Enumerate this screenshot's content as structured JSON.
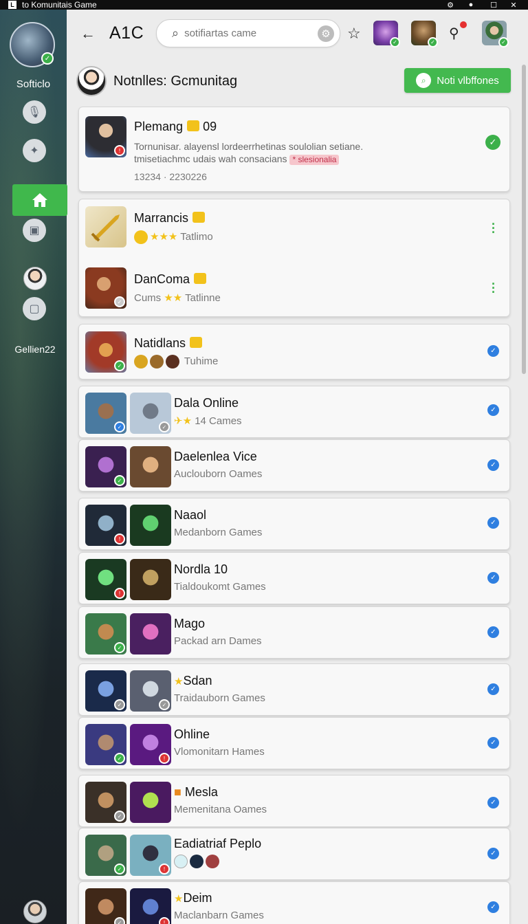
{
  "window": {
    "title": "to Komunitais Game",
    "controls": [
      "settings-icon",
      "record-icon",
      "maximize-icon",
      "close-icon"
    ]
  },
  "sidebar": {
    "profile_name": "Softiclo",
    "label2": "Gellien22"
  },
  "topbar": {
    "title": "A1C",
    "search_placeholder": "sotifiartas came"
  },
  "notifications": {
    "header_title": "Notnlles: Gcmunitag",
    "button_label": "Noti vlbffones"
  },
  "cards": [
    {
      "title": "Plemang",
      "title_suffix": "09",
      "body_line1": "Tornunisar. alayensl lordeerrhetinas soulolian setiane.",
      "body_line2": "tmisetiachmc udais wah consacians",
      "tag": "* slesionalia",
      "date": "13234 · 2230226"
    },
    {
      "title": "Marrancis",
      "sub": "Tatlimo"
    },
    {
      "title": "DanComa",
      "sub_prefix": "Cums",
      "sub": "Tatlinne"
    },
    {
      "title": "Natidlans",
      "sub": "Tuhime"
    },
    {
      "title": "Dala Online",
      "sub": "14  Cames"
    },
    {
      "title": "Daelenlea Vice",
      "sub": "Auclouborn  Oames"
    },
    {
      "title": "Naaol",
      "sub": "Medanborn  Games"
    },
    {
      "title": "Nordla 10",
      "sub": "Tialdoukomt  Games"
    },
    {
      "title": "Mago",
      "sub": "Packad arn  Dames"
    },
    {
      "title": "Sdan",
      "sub": "Traidauborn  Games"
    },
    {
      "title": "Ohline",
      "sub": "Vlomonitarn  Hames"
    },
    {
      "title": "Mesla",
      "sub": "Memenitana  Oames"
    },
    {
      "title": "Eadiatriaf Peplo",
      "sub": ""
    },
    {
      "title": "Deim",
      "sub": "Maclanbarn  Games"
    }
  ]
}
